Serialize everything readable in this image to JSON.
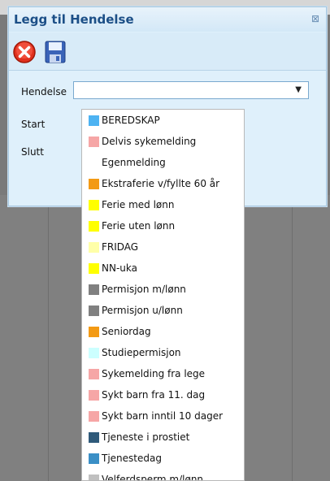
{
  "dialog": {
    "title": "Legg til Hendelse",
    "close_icon": "⊠"
  },
  "toolbar": {
    "cancel_icon": "cancel-circle-icon",
    "save_icon": "floppy-disk-icon"
  },
  "form": {
    "hendelse_label": "Hendelse",
    "start_label": "Start",
    "slutt_label": "Slutt",
    "hendelse_value": "",
    "dropdown_arrow": "▼"
  },
  "options": [
    {
      "label": "BEREDSKAP",
      "color": "#4db3f2"
    },
    {
      "label": "Delvis sykemelding",
      "color": "#f6a6a6"
    },
    {
      "label": "Egenmelding",
      "color": ""
    },
    {
      "label": "Ekstraferie v/fyllte 60 år",
      "color": "#f39a14"
    },
    {
      "label": "Ferie med lønn",
      "color": "#ffff00"
    },
    {
      "label": "Ferie uten lønn",
      "color": "#ffff00"
    },
    {
      "label": "FRIDAG",
      "color": "#ffffa8"
    },
    {
      "label": "NN-uka",
      "color": "#ffff00"
    },
    {
      "label": "Permisjon m/lønn",
      "color": "#808080"
    },
    {
      "label": "Permisjon u/lønn",
      "color": "#808080"
    },
    {
      "label": "Seniordag",
      "color": "#f39a14"
    },
    {
      "label": "Studiepermisjon",
      "color": "#ccffff"
    },
    {
      "label": "Sykemelding fra lege",
      "color": "#f6a6a6"
    },
    {
      "label": "Sykt barn fra 11. dag",
      "color": "#f6a6a6"
    },
    {
      "label": "Sykt barn inntil 10 dager",
      "color": "#f6a6a6"
    },
    {
      "label": "Tjeneste i prostiet",
      "color": "#2f5a7a"
    },
    {
      "label": "Tjenestedag",
      "color": "#3b8fc6"
    },
    {
      "label": "Velferdsperm m/lønn",
      "color": "#c0c0c0"
    }
  ]
}
